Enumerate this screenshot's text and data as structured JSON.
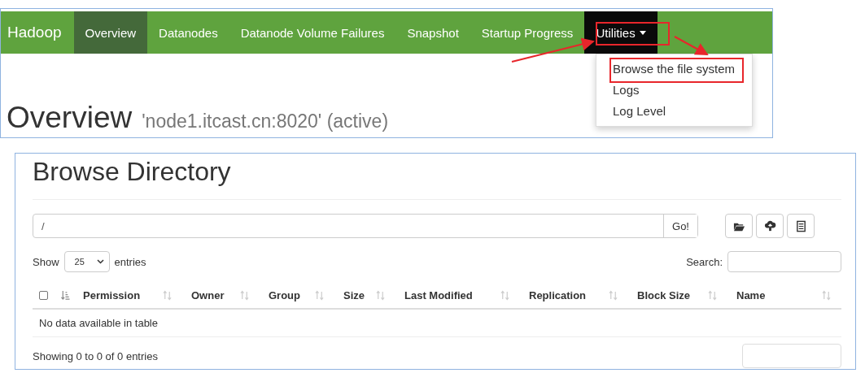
{
  "overview_screen": {
    "brand": "Hadoop",
    "nav_items": [
      {
        "label": "Overview",
        "kind": "link",
        "selected": true
      },
      {
        "label": "Datanodes",
        "kind": "link",
        "selected": false
      },
      {
        "label": "Datanode Volume Failures",
        "kind": "link",
        "selected": false
      },
      {
        "label": "Snapshot",
        "kind": "link",
        "selected": false
      },
      {
        "label": "Startup Progress",
        "kind": "link",
        "selected": false
      },
      {
        "label": "Utilities",
        "kind": "dropdown",
        "selected": false,
        "expanded": true
      }
    ],
    "dropdown_items": [
      "Browse the file system",
      "Logs",
      "Log Level"
    ],
    "heading": "Overview",
    "subheading": "'node1.itcast.cn:8020' (active)"
  },
  "browse_screen": {
    "title": "Browse Directory",
    "path": {
      "value": "/"
    },
    "go_button": "Go!",
    "show_label": "Show",
    "page_size": "25",
    "entries_label": "entries",
    "search_label": "Search:",
    "table": {
      "columns": [
        {
          "kind": "checkbox",
          "checked": false,
          "sorted": true
        },
        {
          "label": "Permission",
          "kind": "text",
          "sorted": false
        },
        {
          "label": "Owner",
          "kind": "text",
          "sorted": false
        },
        {
          "label": "Group",
          "kind": "text",
          "sorted": false
        },
        {
          "label": "Size",
          "kind": "text",
          "sorted": false
        },
        {
          "label": "Last Modified",
          "kind": "text",
          "sorted": false
        },
        {
          "label": "Replication",
          "kind": "text",
          "sorted": false
        },
        {
          "label": "Block Size",
          "kind": "text",
          "sorted": false
        },
        {
          "label": "Name",
          "kind": "text",
          "sorted": false
        }
      ],
      "empty_message": "No data available in table"
    },
    "info": "Showing 0 to 0 of 0 entries"
  }
}
